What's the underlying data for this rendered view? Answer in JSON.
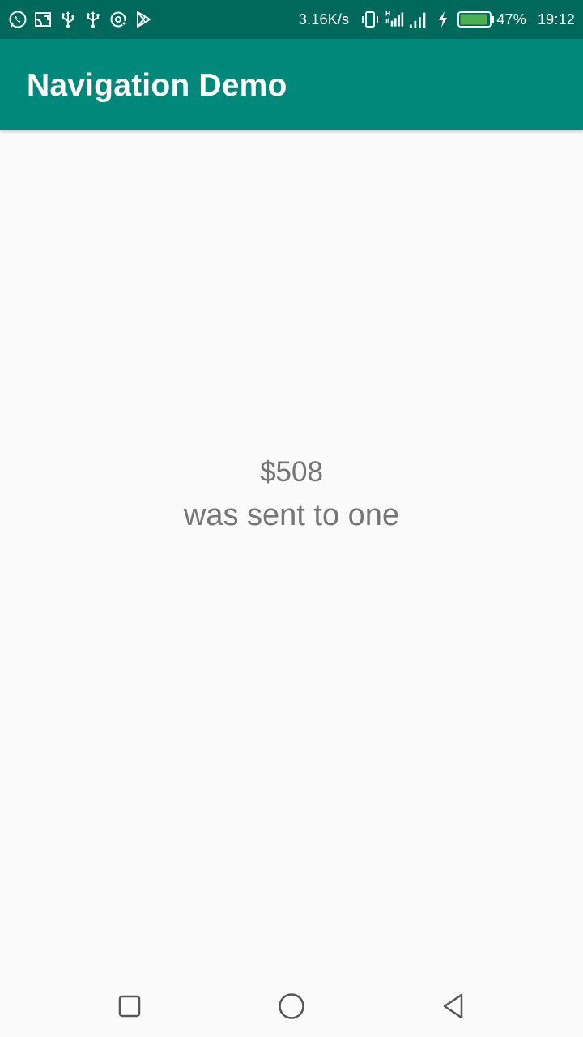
{
  "status_bar": {
    "network_speed": "3.16K/s",
    "battery_percent": "47%",
    "time": "19:12",
    "left_icons": [
      "whatsapp-icon",
      "cast-icon",
      "usb-icon",
      "usb-icon",
      "sync-icon",
      "play-store-icon"
    ],
    "right_icons": [
      "vibrate-icon",
      "signal-h-icon",
      "signal-icon",
      "charging-icon",
      "battery-icon"
    ],
    "battery_level": 0.47
  },
  "app_bar": {
    "title": "Navigation Demo"
  },
  "content": {
    "amount": "$508",
    "message": "was sent to one"
  },
  "nav_bar": {
    "buttons": [
      "recents-icon",
      "home-icon",
      "back-icon"
    ]
  },
  "colors": {
    "status_bar": "#00695c",
    "app_bar": "#00897b",
    "background": "#fafafa",
    "text_secondary": "#757575",
    "battery_fill": "#4caf50"
  }
}
